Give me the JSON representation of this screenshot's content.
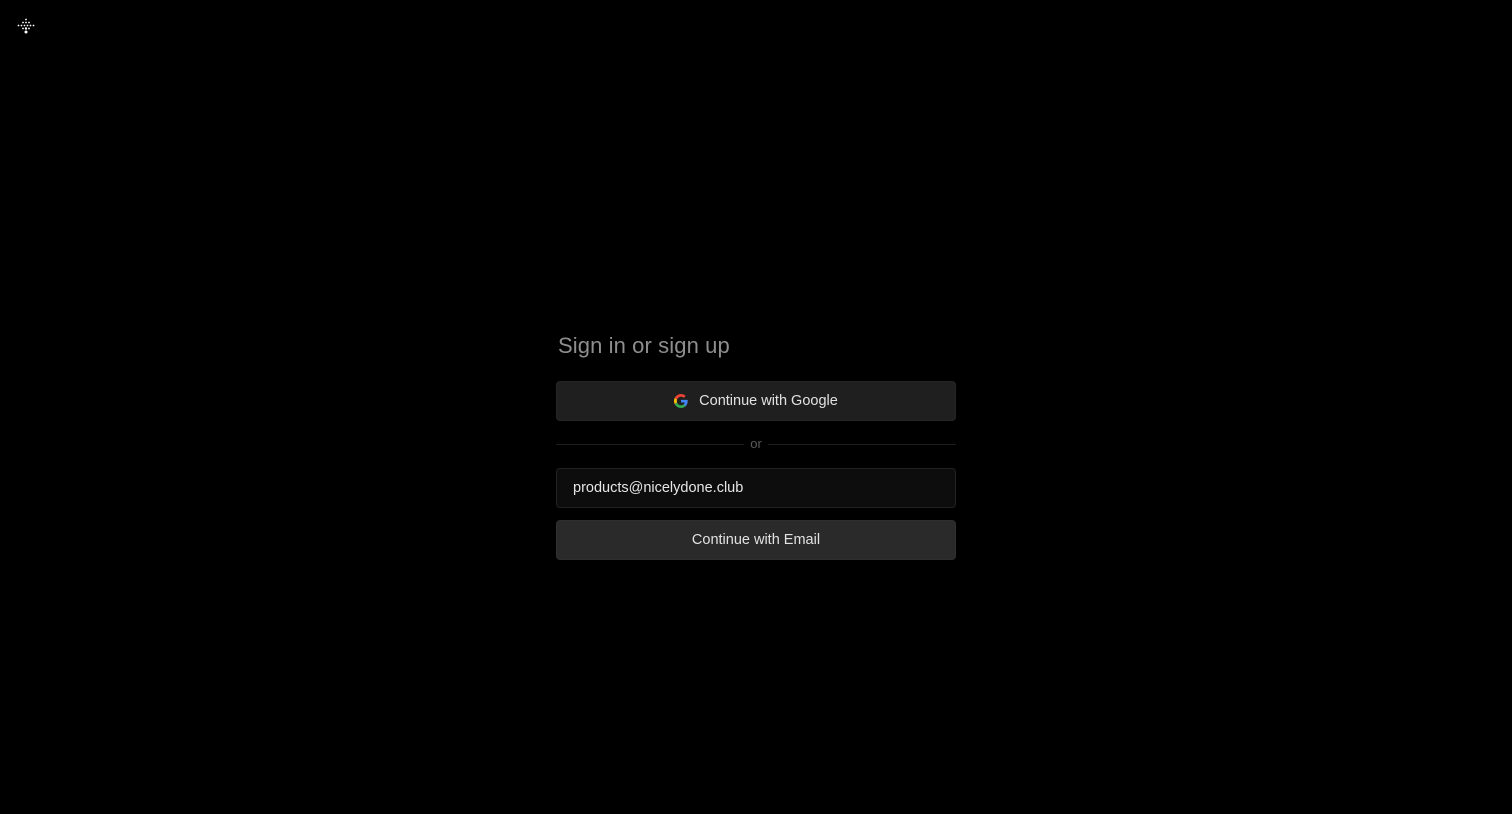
{
  "logo": {
    "icon": "dotted-arrow-logo-icon",
    "color": "#ffffff"
  },
  "auth": {
    "title": "Sign in or sign up",
    "google_button_label": "Continue with Google",
    "google_icon": "google-g-icon",
    "divider_text": "or",
    "email_value": "products@nicelydone.club",
    "email_placeholder": "",
    "email_button_label": "Continue with Email"
  },
  "colors": {
    "background": "#000000",
    "button_bg": "#1f1f1f",
    "email_button_bg": "#2a2a2a",
    "title": "#8e8e8e",
    "text": "#e2e2e2"
  }
}
